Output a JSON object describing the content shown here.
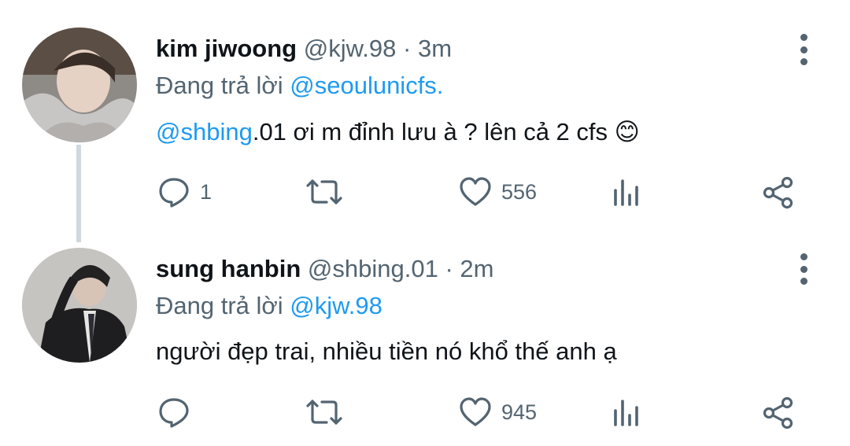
{
  "tweets": [
    {
      "name": "kim jiwoong",
      "handle": "@kjw.98",
      "separator": "·",
      "time": "3m",
      "reply_prefix": "Đang trả lời",
      "reply_to": "@seoulunicfs.",
      "mention": "@shbing",
      "text": ".01 ơi m đỉnh lưu à ? lên cả 2 cfs",
      "emoji": "😊",
      "reply_count": "1",
      "like_count": "556"
    },
    {
      "name": "sung hanbin",
      "handle": "@shbing.01",
      "separator": "·",
      "time": "2m",
      "reply_prefix": "Đang trả lời",
      "reply_to": "@kjw.98",
      "text": "người đẹp trai, nhiều tiền nó khổ thế anh ạ",
      "like_count": "945"
    }
  ],
  "colors": {
    "link": "#1d9bf0",
    "muted": "#536471",
    "thread_line": "#cfd9de"
  },
  "icons": [
    "more-vertical-icon",
    "reply-icon",
    "retweet-icon",
    "like-icon",
    "analytics-icon",
    "share-icon"
  ]
}
